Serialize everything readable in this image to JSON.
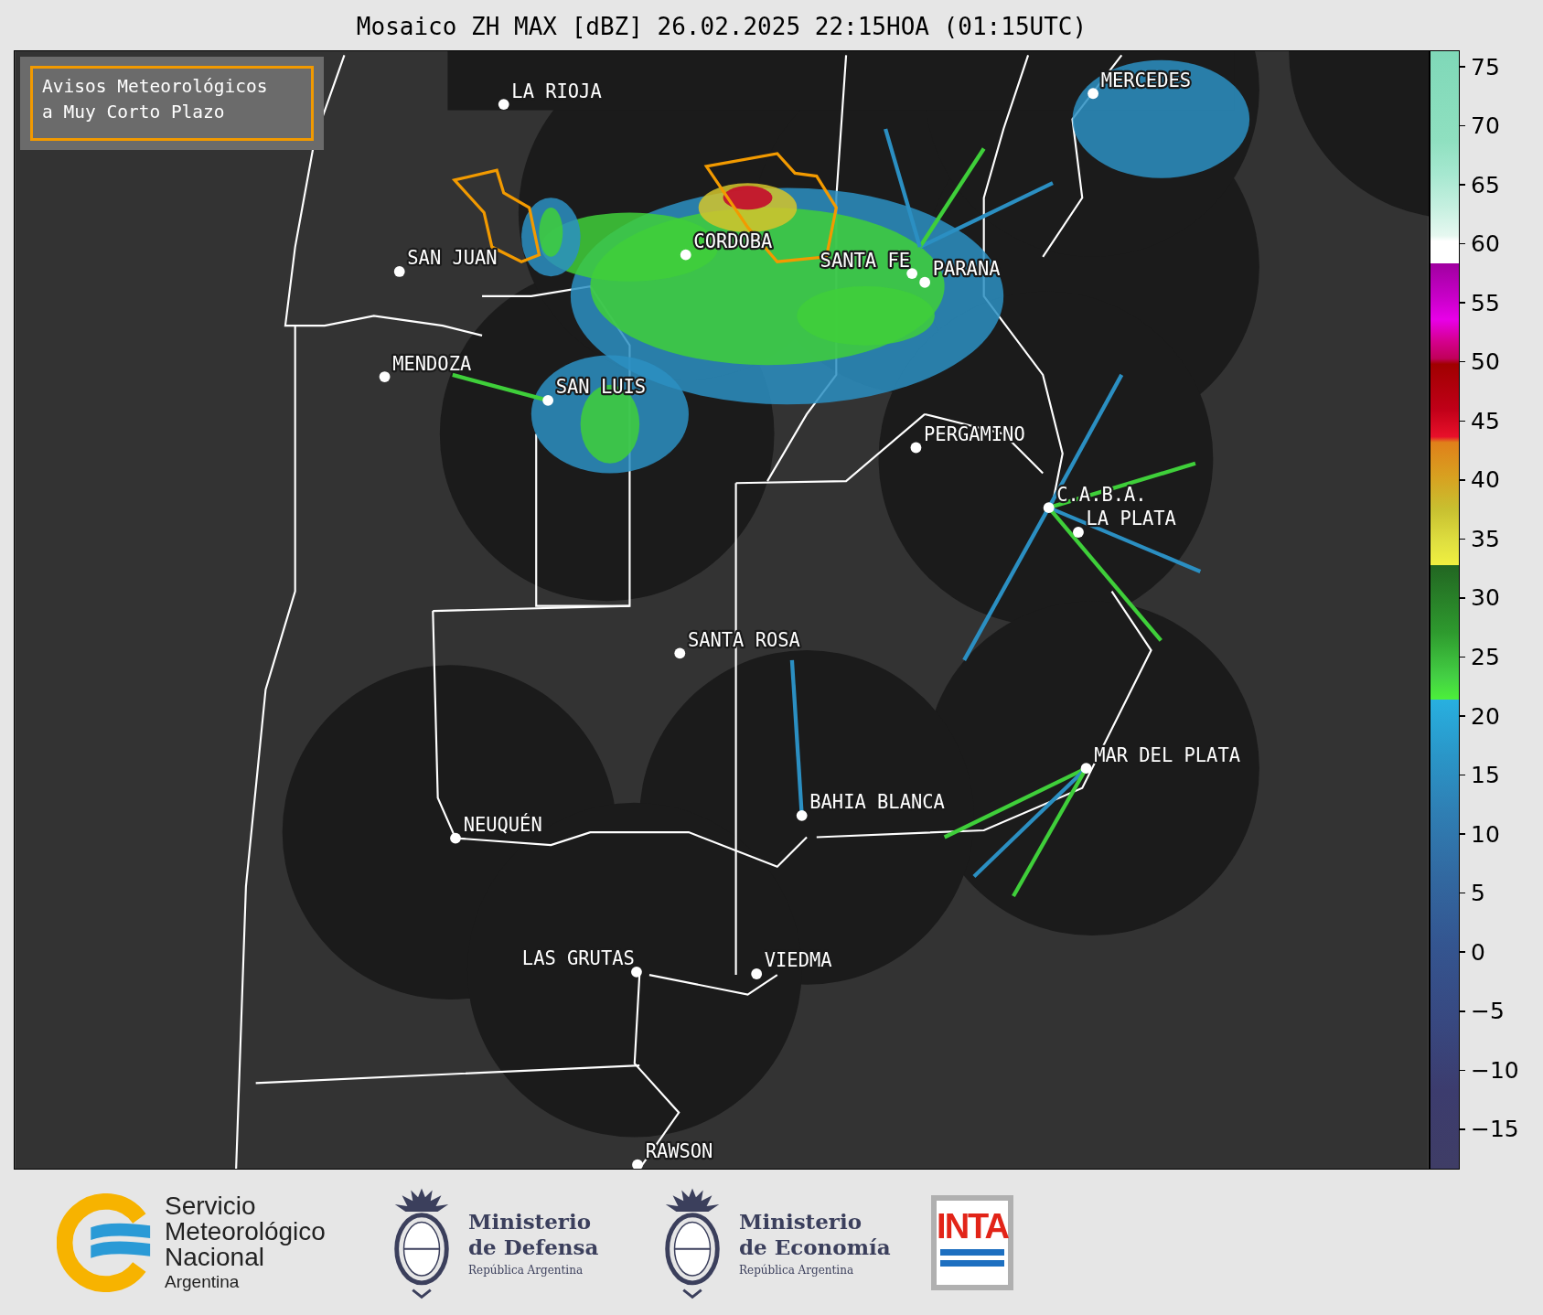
{
  "title": "Mosaico ZH MAX [dBZ] 26.02.2025 22:15HOA (01:15UTC)",
  "notice": "Avisos Meteorológicos\na Muy Corto Plazo",
  "cities": [
    {
      "name": "LA RIOJA"
    },
    {
      "name": "MERCEDES"
    },
    {
      "name": "CORDOBA"
    },
    {
      "name": "SAN JUAN"
    },
    {
      "name": "SANTA FE"
    },
    {
      "name": "PARANA"
    },
    {
      "name": "MENDOZA"
    },
    {
      "name": "SAN LUIS"
    },
    {
      "name": "PERGAMINO"
    },
    {
      "name": "C.A.B.A."
    },
    {
      "name": "LA PLATA"
    },
    {
      "name": "SANTA ROSA"
    },
    {
      "name": "MAR DEL PLATA"
    },
    {
      "name": "BAHIA BLANCA"
    },
    {
      "name": "NEUQUÉN"
    },
    {
      "name": "LAS GRUTAS"
    },
    {
      "name": "VIEDMA"
    },
    {
      "name": "RAWSON"
    }
  ],
  "colorbar": {
    "ticks": [
      "75",
      "70",
      "65",
      "60",
      "55",
      "50",
      "45",
      "40",
      "35",
      "30",
      "25",
      "20",
      "15",
      "10",
      "5",
      "0",
      "−5",
      "−10",
      "−15"
    ]
  },
  "logos": [
    {
      "kind": "smn",
      "lines": [
        "Servicio",
        "Meteorológico",
        "Nacional"
      ],
      "country": "Argentina"
    },
    {
      "kind": "ministry",
      "lines": [
        "Ministerio",
        "de Defensa"
      ],
      "country": "República Argentina"
    },
    {
      "kind": "ministry",
      "lines": [
        "Ministerio",
        "de Economía"
      ],
      "country": "República Argentina"
    },
    {
      "kind": "inta",
      "lines": [
        "INTA"
      ]
    }
  ]
}
